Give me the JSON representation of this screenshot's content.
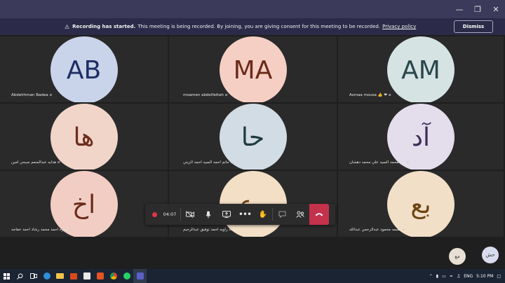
{
  "window": {
    "minimize_icon": "—",
    "restore_icon": "❐",
    "close_icon": "✕"
  },
  "banner": {
    "title": "Recording has started.",
    "message": "This meeting is being recorded. By joining, you are giving consent for this meeting to be recorded.",
    "link": "Privacy policy",
    "dismiss_label": "Dismiss"
  },
  "participants": [
    {
      "initials": "AB",
      "name": "Abdelrhman Badea",
      "color": "#c9d4ea",
      "text_color": "#1e2e63"
    },
    {
      "initials": "MA",
      "name": "moamen abdelfattah",
      "color": "#f5cfc4",
      "text_color": "#6b2a1a"
    },
    {
      "initials": "AM",
      "name": "Asmaa mousa 👍 ❤",
      "color": "#d5e3e3",
      "text_color": "#29474a"
    },
    {
      "initials": "ها",
      "name": "هدايه عبدالمنعم صبحي امين",
      "color": "#f2d5c9",
      "text_color": "#6c2e1c"
    },
    {
      "initials": "حا",
      "name": "حاتم احمد السيد احمد الزيني",
      "color": "#d2dce4",
      "text_color": "#1f3a3c"
    },
    {
      "initials": "آد",
      "name": "آدم محمد السيد علي محمد دهشان",
      "color": "#e3ddec",
      "text_color": "#3b2e57"
    },
    {
      "initials": "اخ",
      "name": "اميره احمد محمد رشاد احمد خفاجه",
      "color": "#f2cdc3",
      "text_color": "#6b2a1a"
    },
    {
      "initials": "رع",
      "name": "راويه احمد توفيق عبدالرحيم",
      "color": "#f3dfc6",
      "text_color": "#6c4512"
    },
    {
      "initials": "بع",
      "name": "بسمه محمود عبدالرحمن عبدالله",
      "color": "#f1dfc8",
      "text_color": "#6c4512"
    }
  ],
  "mini_avatars": [
    {
      "initials": "مع",
      "color": "#e8e0d4"
    },
    {
      "initials": "حش",
      "color": "#d9dbee"
    }
  ],
  "callbar": {
    "timer": "04:07",
    "camera_icon": "camera-off-icon",
    "mic_icon": "mic-icon",
    "share_icon": "share-screen-icon",
    "more_icon": "more-icon",
    "raise_hand_icon": "raise-hand-icon",
    "chat_icon": "chat-icon",
    "people_icon": "people-icon",
    "hangup_icon": "hang-up-icon"
  },
  "taskbar": {
    "language": "ENG",
    "time": "5:10 PM"
  }
}
